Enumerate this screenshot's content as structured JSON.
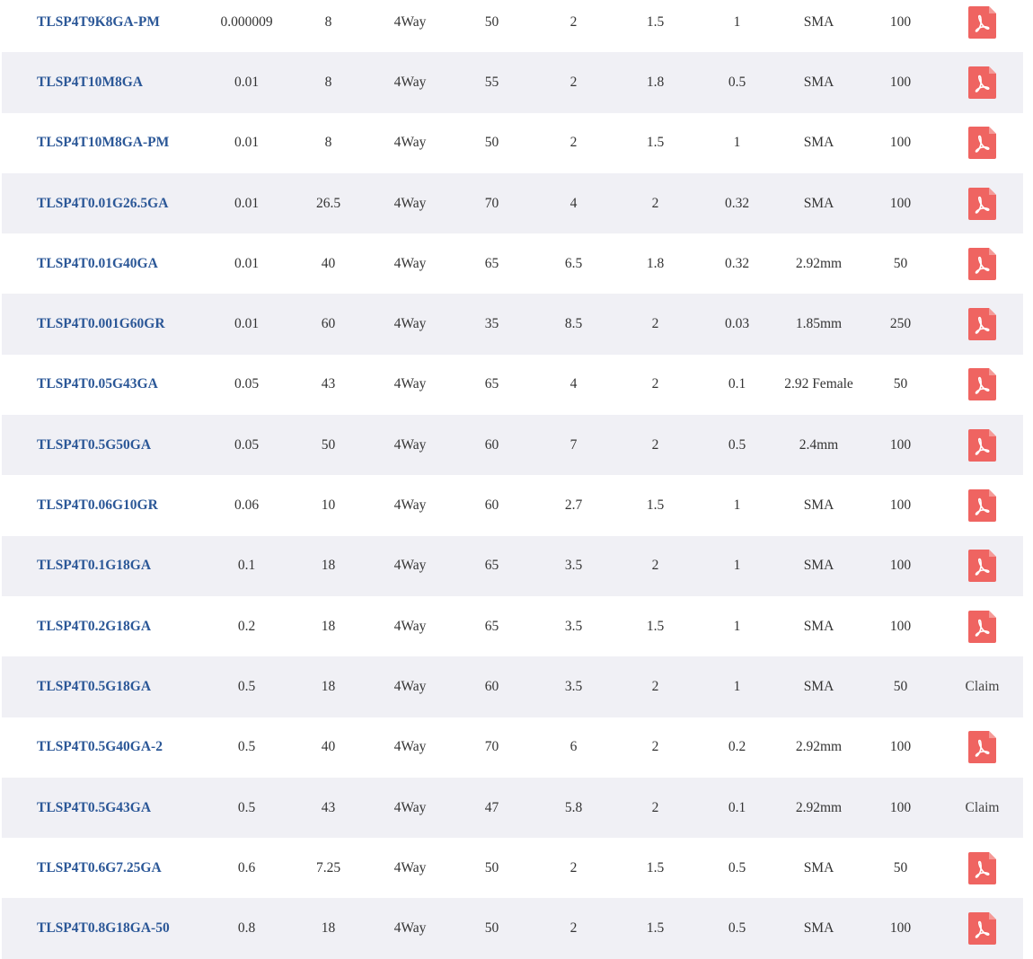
{
  "colors": {
    "link": "#2b5797",
    "row_alt": "#f0f0f5",
    "pdf_icon": "#ef6461"
  },
  "rows": [
    {
      "model": "TLSP4T9K8GA-PM",
      "c1": "0.000009",
      "c2": "8",
      "c3": "4Way",
      "c4": "50",
      "c5": "2",
      "c6": "1.5",
      "c7": "1",
      "c8": "SMA",
      "c9": "100",
      "doc": "pdf-icon"
    },
    {
      "model": "TLSP4T10M8GA",
      "c1": "0.01",
      "c2": "8",
      "c3": "4Way",
      "c4": "55",
      "c5": "2",
      "c6": "1.8",
      "c7": "0.5",
      "c8": "SMA",
      "c9": "100",
      "doc": "pdf-icon"
    },
    {
      "model": "TLSP4T10M8GA-PM",
      "c1": "0.01",
      "c2": "8",
      "c3": "4Way",
      "c4": "50",
      "c5": "2",
      "c6": "1.5",
      "c7": "1",
      "c8": "SMA",
      "c9": "100",
      "doc": "pdf-icon"
    },
    {
      "model": "TLSP4T0.01G26.5GA",
      "c1": "0.01",
      "c2": "26.5",
      "c3": "4Way",
      "c4": "70",
      "c5": "4",
      "c6": "2",
      "c7": "0.32",
      "c8": "SMA",
      "c9": "100",
      "doc": "pdf-icon"
    },
    {
      "model": "TLSP4T0.01G40GA",
      "c1": "0.01",
      "c2": "40",
      "c3": "4Way",
      "c4": "65",
      "c5": "6.5",
      "c6": "1.8",
      "c7": "0.32",
      "c8": "2.92mm",
      "c9": "50",
      "doc": "pdf-icon"
    },
    {
      "model": "TLSP4T0.001G60GR",
      "c1": "0.01",
      "c2": "60",
      "c3": "4Way",
      "c4": "35",
      "c5": "8.5",
      "c6": "2",
      "c7": "0.03",
      "c8": "1.85mm",
      "c9": "250",
      "doc": "pdf-icon"
    },
    {
      "model": "TLSP4T0.05G43GA",
      "c1": "0.05",
      "c2": "43",
      "c3": "4Way",
      "c4": "65",
      "c5": "4",
      "c6": "2",
      "c7": "0.1",
      "c8": "2.92 Female",
      "c9": "50",
      "doc": "pdf-icon"
    },
    {
      "model": "TLSP4T0.5G50GA",
      "c1": "0.05",
      "c2": "50",
      "c3": "4Way",
      "c4": "60",
      "c5": "7",
      "c6": "2",
      "c7": "0.5",
      "c8": "2.4mm",
      "c9": "100",
      "doc": "pdf-icon"
    },
    {
      "model": "TLSP4T0.06G10GR",
      "c1": "0.06",
      "c2": "10",
      "c3": "4Way",
      "c4": "60",
      "c5": "2.7",
      "c6": "1.5",
      "c7": "1",
      "c8": "SMA",
      "c9": "100",
      "doc": "pdf-icon"
    },
    {
      "model": "TLSP4T0.1G18GA",
      "c1": "0.1",
      "c2": "18",
      "c3": "4Way",
      "c4": "65",
      "c5": "3.5",
      "c6": "2",
      "c7": "1",
      "c8": "SMA",
      "c9": "100",
      "doc": "pdf-icon"
    },
    {
      "model": "TLSP4T0.2G18GA",
      "c1": "0.2",
      "c2": "18",
      "c3": "4Way",
      "c4": "65",
      "c5": "3.5",
      "c6": "1.5",
      "c7": "1",
      "c8": "SMA",
      "c9": "100",
      "doc": "pdf-icon"
    },
    {
      "model": "TLSP4T0.5G18GA",
      "c1": "0.5",
      "c2": "18",
      "c3": "4Way",
      "c4": "60",
      "c5": "3.5",
      "c6": "2",
      "c7": "1",
      "c8": "SMA",
      "c9": "50",
      "doc": "Claim"
    },
    {
      "model": "TLSP4T0.5G40GA-2",
      "c1": "0.5",
      "c2": "40",
      "c3": "4Way",
      "c4": "70",
      "c5": "6",
      "c6": "2",
      "c7": "0.2",
      "c8": "2.92mm",
      "c9": "100",
      "doc": "pdf-icon"
    },
    {
      "model": "TLSP4T0.5G43GA",
      "c1": "0.5",
      "c2": "43",
      "c3": "4Way",
      "c4": "47",
      "c5": "5.8",
      "c6": "2",
      "c7": "0.1",
      "c8": "2.92mm",
      "c9": "100",
      "doc": "Claim"
    },
    {
      "model": "TLSP4T0.6G7.25GA",
      "c1": "0.6",
      "c2": "7.25",
      "c3": "4Way",
      "c4": "50",
      "c5": "2",
      "c6": "1.5",
      "c7": "0.5",
      "c8": "SMA",
      "c9": "50",
      "doc": "pdf-icon"
    },
    {
      "model": "TLSP4T0.8G18GA-50",
      "c1": "0.8",
      "c2": "18",
      "c3": "4Way",
      "c4": "50",
      "c5": "2",
      "c6": "1.5",
      "c7": "0.5",
      "c8": "SMA",
      "c9": "100",
      "doc": "pdf-icon"
    }
  ]
}
